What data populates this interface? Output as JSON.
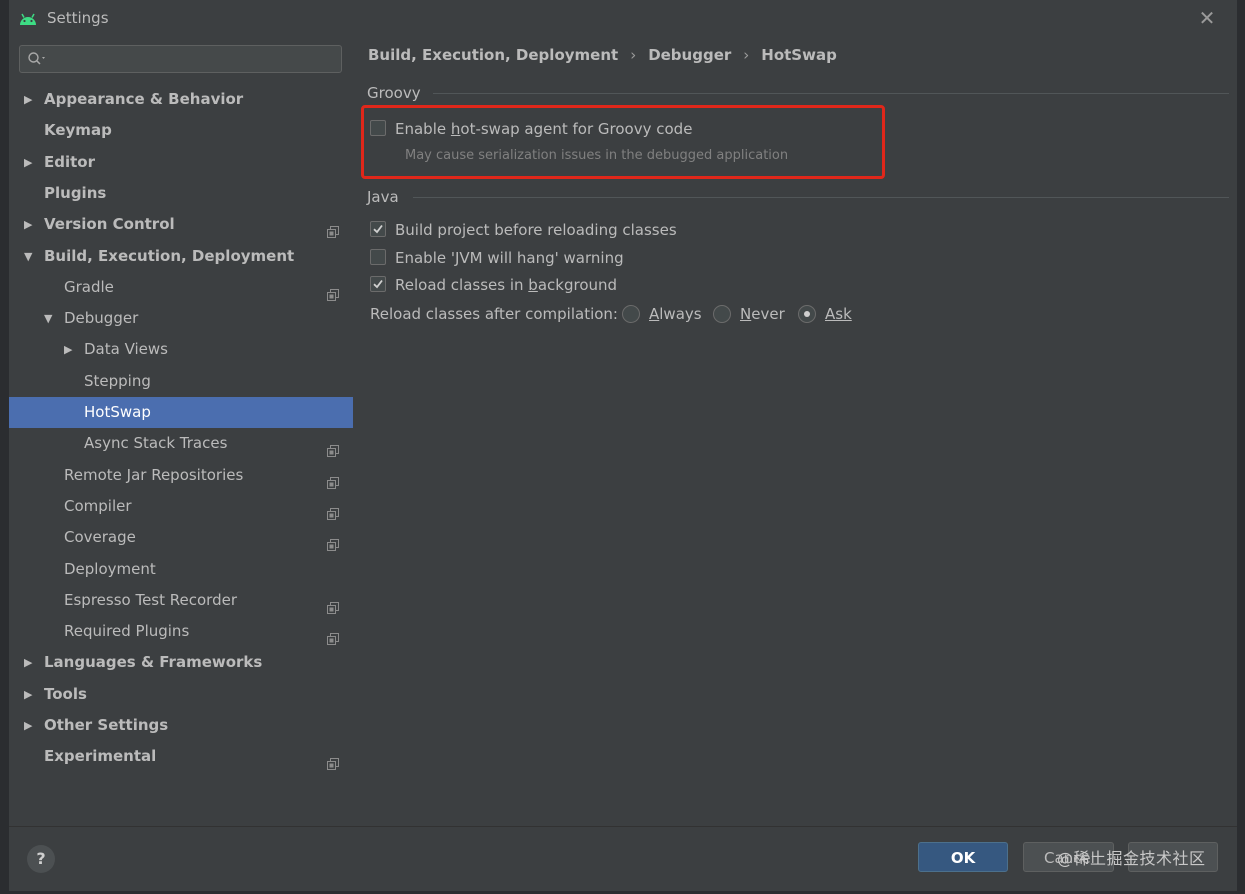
{
  "window": {
    "title": "Settings",
    "close_glyph": "✕"
  },
  "search": {
    "placeholder": ""
  },
  "sidebar": {
    "items": [
      {
        "label": "Appearance & Behavior",
        "bold": true,
        "arrow": "▶",
        "level": 0,
        "shared": false
      },
      {
        "label": "Keymap",
        "bold": true,
        "arrow": "",
        "level": 0,
        "shared": false
      },
      {
        "label": "Editor",
        "bold": true,
        "arrow": "▶",
        "level": 0,
        "shared": false
      },
      {
        "label": "Plugins",
        "bold": true,
        "arrow": "",
        "level": 0,
        "shared": false
      },
      {
        "label": "Version Control",
        "bold": true,
        "arrow": "▶",
        "level": 0,
        "shared": true
      },
      {
        "label": "Build, Execution, Deployment",
        "bold": true,
        "arrow": "▼",
        "level": 0,
        "shared": false
      },
      {
        "label": "Gradle",
        "bold": false,
        "arrow": "",
        "level": 1,
        "shared": true
      },
      {
        "label": "Debugger",
        "bold": false,
        "arrow": "▼",
        "level": 1,
        "shared": false
      },
      {
        "label": "Data Views",
        "bold": false,
        "arrow": "▶",
        "level": 2,
        "shared": false
      },
      {
        "label": "Stepping",
        "bold": false,
        "arrow": "",
        "level": 2,
        "shared": false
      },
      {
        "label": "HotSwap",
        "bold": false,
        "arrow": "",
        "level": 2,
        "shared": false,
        "selected": true
      },
      {
        "label": "Async Stack Traces",
        "bold": false,
        "arrow": "",
        "level": 2,
        "shared": true
      },
      {
        "label": "Remote Jar Repositories",
        "bold": false,
        "arrow": "",
        "level": 1,
        "shared": true
      },
      {
        "label": "Compiler",
        "bold": false,
        "arrow": "",
        "level": 1,
        "shared": true
      },
      {
        "label": "Coverage",
        "bold": false,
        "arrow": "",
        "level": 1,
        "shared": true
      },
      {
        "label": "Deployment",
        "bold": false,
        "arrow": "",
        "level": 1,
        "shared": false
      },
      {
        "label": "Espresso Test Recorder",
        "bold": false,
        "arrow": "",
        "level": 1,
        "shared": true
      },
      {
        "label": "Required Plugins",
        "bold": false,
        "arrow": "",
        "level": 1,
        "shared": true
      },
      {
        "label": "Languages & Frameworks",
        "bold": true,
        "arrow": "▶",
        "level": 0,
        "shared": false
      },
      {
        "label": "Tools",
        "bold": true,
        "arrow": "▶",
        "level": 0,
        "shared": false
      },
      {
        "label": "Other Settings",
        "bold": true,
        "arrow": "▶",
        "level": 0,
        "shared": false
      },
      {
        "label": "Experimental",
        "bold": true,
        "arrow": "",
        "level": 0,
        "shared": true
      }
    ]
  },
  "breadcrumb": {
    "parts": [
      "Build, Execution, Deployment",
      "Debugger",
      "HotSwap"
    ],
    "separator": "›"
  },
  "groovy": {
    "title": "Groovy",
    "hotswap_pre": "Enable ",
    "hotswap_mn": "h",
    "hotswap_post": "ot-swap agent for Groovy code",
    "hotswap_checked": false,
    "hint": "May cause serialization issues in the debugged application",
    "highlight_color": "#e0271a"
  },
  "java": {
    "title": "Java",
    "build_label": "Build project before reloading classes",
    "build_checked": true,
    "jvm_label": "Enable 'JVM will hang' warning",
    "jvm_checked": false,
    "reload_pre": "Reload classes in ",
    "reload_mn": "b",
    "reload_post": "ackground",
    "reload_checked": true,
    "after_label": "Reload classes after compilation:",
    "options": [
      {
        "mn": "A",
        "rest": "lways",
        "selected": false
      },
      {
        "mn": "N",
        "rest": "ever",
        "selected": false
      },
      {
        "mn": "",
        "rest": "Ask",
        "selected": true
      }
    ]
  },
  "footer": {
    "help": "?",
    "ok": "OK",
    "cancel": "Cancel",
    "apply": "",
    "watermark": "@稀土掘金技术社区"
  },
  "colors": {
    "accent": "#4b6eaf",
    "ok_button": "#365880"
  }
}
